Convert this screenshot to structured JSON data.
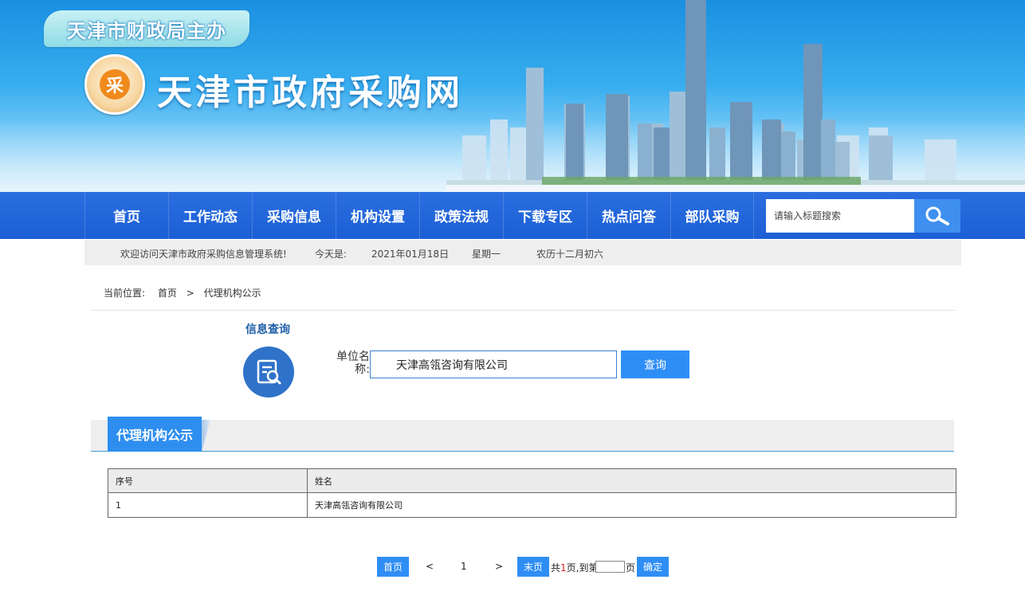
{
  "banner": {
    "sponsor": "天津市财政局主办",
    "site_title": "天津市政府采购网",
    "logo_char": "采"
  },
  "nav": {
    "items": [
      "首页",
      "工作动态",
      "采购信息",
      "机构设置",
      "政策法规",
      "下载专区",
      "热点问答",
      "部队采购"
    ],
    "search_placeholder": "请输入标题搜索"
  },
  "infobar": {
    "welcome": "欢迎访问天津市政府采购信息管理系统!",
    "today_label": "今天是:",
    "date": "2021年01月18日",
    "weekday": "星期一",
    "lunar": "农历十二月初六"
  },
  "breadcrumb": {
    "label": "当前位置:",
    "home": "首页",
    "separator": ">",
    "current": "代理机构公示"
  },
  "query": {
    "title": "信息查询",
    "field_label": "单位名称:",
    "field_value": "天津高瓴咨询有限公司",
    "button": "查询"
  },
  "section": {
    "title": "代理机构公示"
  },
  "table": {
    "headers": [
      "序号",
      "姓名"
    ],
    "rows": [
      [
        "1",
        "天津高瓴咨询有限公司"
      ]
    ]
  },
  "pager": {
    "first": "首页",
    "prev": "<",
    "current_page": "1",
    "next": ">",
    "last": "末页",
    "total_prefix": "共",
    "total_pages": "1",
    "total_suffix": "页,到第",
    "goto_suffix": "页",
    "confirm": "确定"
  },
  "colors": {
    "nav_bg": "#1c5fd5",
    "accent": "#2f8ef5",
    "section_tab": "#2e8ef0",
    "query_title": "#1f5ea8"
  }
}
